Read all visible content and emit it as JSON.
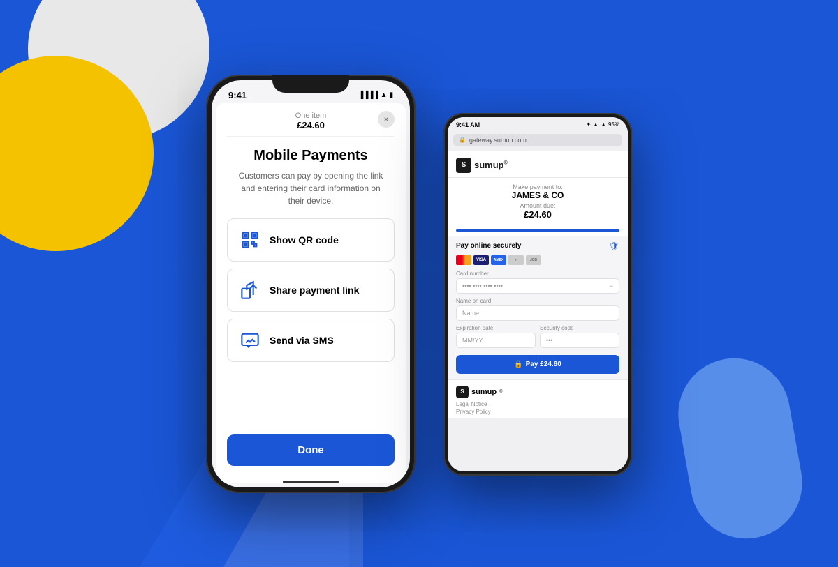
{
  "background": {
    "primary_color": "#1a56d6",
    "accent_yellow": "#f5c200",
    "accent_white": "#e8e8e8",
    "accent_light_blue": "#93c5fd"
  },
  "left_phone": {
    "status_time": "9:41",
    "header_subtitle": "One item",
    "header_amount": "£24.60",
    "close_button_label": "×",
    "main_title": "Mobile Payments",
    "description": "Customers can pay by opening the link and entering their card information on their device.",
    "actions": [
      {
        "id": "qr",
        "label": "Show QR code"
      },
      {
        "id": "share",
        "label": "Share payment link"
      },
      {
        "id": "sms",
        "label": "Send via SMS"
      }
    ],
    "done_button_label": "Done"
  },
  "right_phone": {
    "status_time": "9:41 AM",
    "status_battery": "95%",
    "url": "gateway.sumup.com",
    "logo_text": "sumup",
    "logo_reg": "®",
    "payment_to_label": "Make payment to:",
    "merchant_name": "JAMES & CO",
    "amount_label": "Amount due:",
    "amount_value": "£24.60",
    "section_title": "Pay online securely",
    "card_number_label": "Card number",
    "card_number_placeholder": "•••• •••• •••• ••••",
    "name_label": "Name on card",
    "name_placeholder": "Name",
    "expiry_label": "Expiration date",
    "expiry_placeholder": "MM/YY",
    "security_label": "Security code",
    "security_placeholder": "•••",
    "pay_button_label": "Pay £24.60",
    "footer_logo": "sumup",
    "footer_legal": "Legal Notice",
    "footer_privacy": "Privacy Policy"
  }
}
